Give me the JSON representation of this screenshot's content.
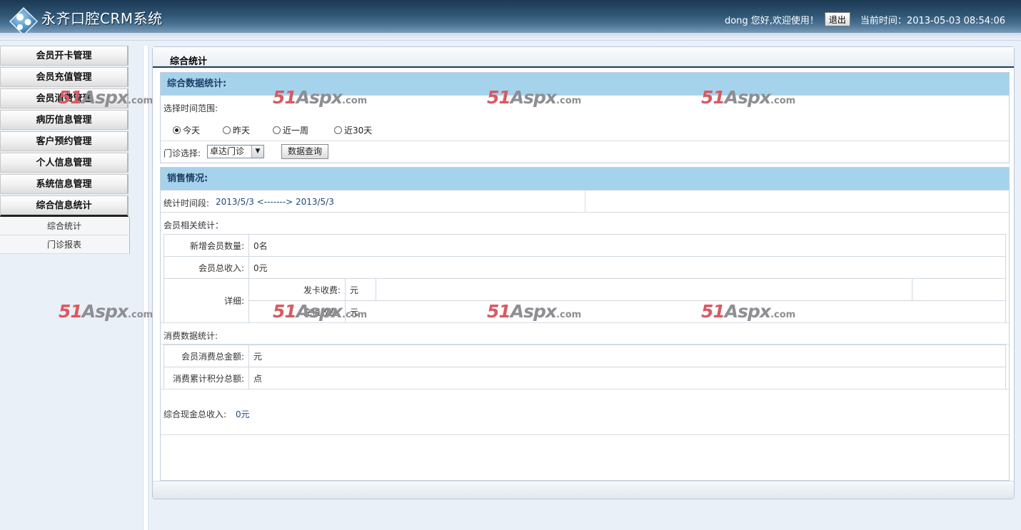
{
  "header": {
    "app_title": "永齐口腔CRM系统",
    "greeting": "dong 您好,欢迎使用！",
    "logout_label": "退出",
    "current_time": "当前时间：2013-05-03 08:54:06"
  },
  "sidebar": {
    "items": [
      {
        "label": "会员开卡管理"
      },
      {
        "label": "会员充值管理"
      },
      {
        "label": "会员消费管理"
      },
      {
        "label": "病历信息管理"
      },
      {
        "label": "客户预约管理"
      },
      {
        "label": "个人信息管理"
      },
      {
        "label": "系统信息管理"
      },
      {
        "label": "综合信息统计"
      }
    ],
    "subitems": [
      {
        "label": "综合统计"
      },
      {
        "label": "门诊报表"
      }
    ]
  },
  "main": {
    "panel_title": "综合统计",
    "summary": {
      "heading": "综合数据统计:",
      "range_label": "选择时间范围:",
      "radios": [
        {
          "label": "今天",
          "checked": true
        },
        {
          "label": "昨天",
          "checked": false
        },
        {
          "label": "近一周",
          "checked": false
        },
        {
          "label": "近30天",
          "checked": false
        }
      ],
      "clinic_label": "门诊选择:",
      "clinic_value": "卓达门诊",
      "query_button": "数据查询"
    },
    "sales": {
      "heading": "销售情况:",
      "period_label": "统计时间段:",
      "period_value": "2013/5/3 <-------> 2013/5/3",
      "member_stats_label": "会员相关统计：",
      "new_members_label": "新增会员数量:",
      "new_members_value": "0名",
      "member_income_label": "会员总收入:",
      "member_income_value": "0元",
      "detail_label": "详细:",
      "card_fee_label": "发卡收费:",
      "card_fee_value": "元",
      "recharge_fee_label": "充值收费:",
      "recharge_fee_value": "元",
      "consume_stats_label": "消费数据统计:",
      "consume_total_label": "会员消费总金额:",
      "consume_total_value": "元",
      "points_total_label": "消费累计积分总额:",
      "points_total_value": "点",
      "cash_income_label": "综合现金总收入:",
      "cash_income_value": "0元"
    }
  },
  "watermark": {
    "num": "51",
    "asp": "Aspx",
    "com": ".com"
  },
  "colors": {
    "header_dark": "#1c3953",
    "section_header": "#a5d3ec",
    "section_text": "#1f3e66",
    "watermark_red": "#d85a62"
  }
}
